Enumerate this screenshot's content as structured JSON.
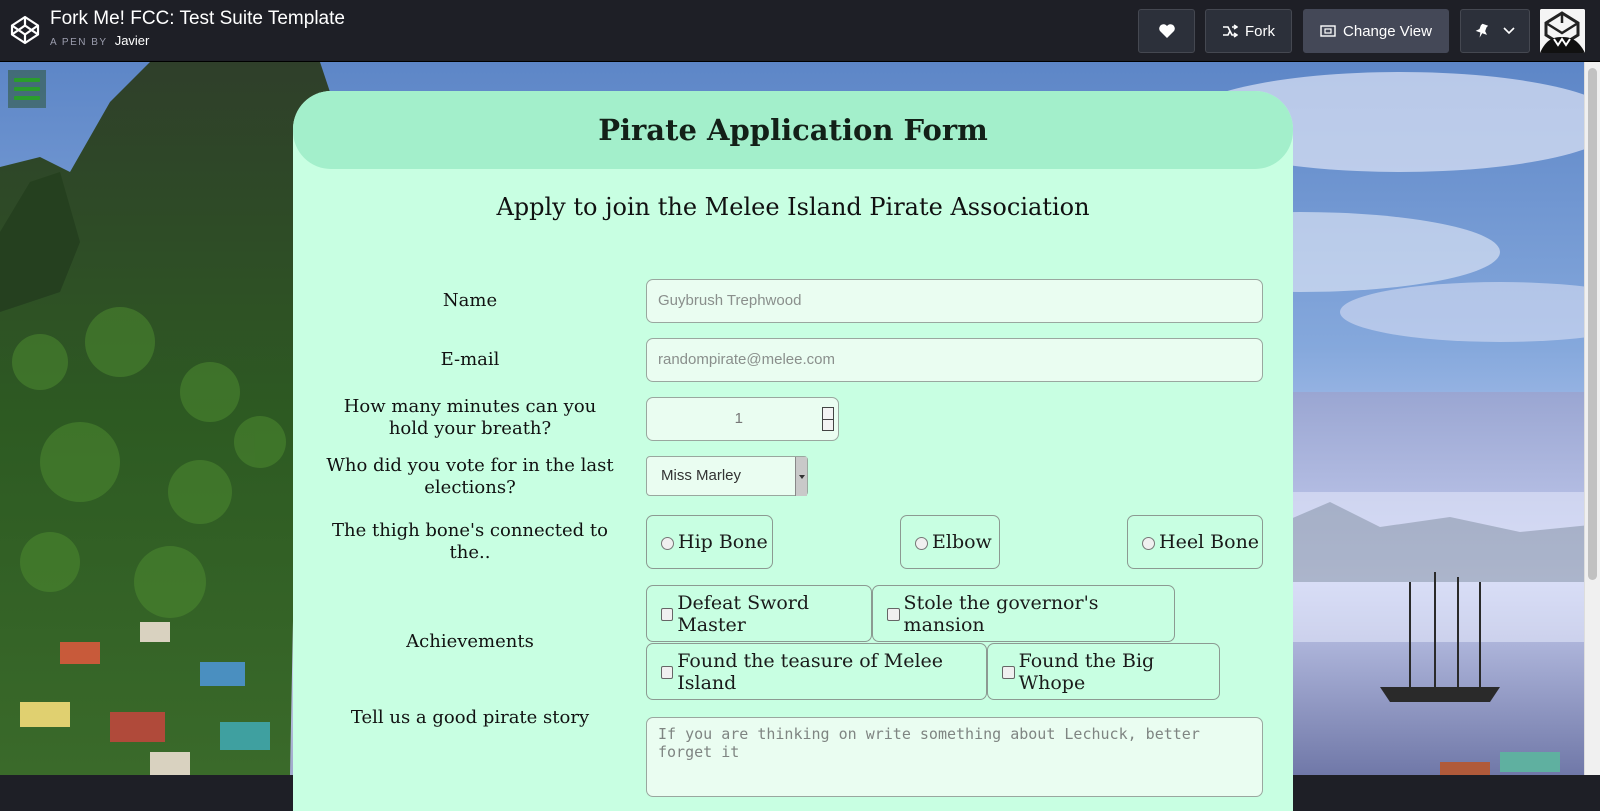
{
  "topbar": {
    "pen_title": "Fork Me! FCC: Test Suite Template",
    "pen_by_prefix": "A PEN BY",
    "author": "Javier",
    "fork_label": "Fork",
    "change_view_label": "Change View"
  },
  "form": {
    "title": "Pirate Application Form",
    "subtitle": "Apply to join the Melee Island Pirate Association",
    "name_label": "Name",
    "name_placeholder": "Guybrush Trephwood",
    "email_label": "E-mail",
    "email_placeholder": "randompirate@melee.com",
    "breath_label": "How many minutes can you hold your breath?",
    "breath_value": "1",
    "vote_label": "Who did you vote for in the last elections?",
    "vote_selected": "Miss Marley",
    "thigh_label": "The thigh bone's connected to the..",
    "thigh_options": [
      "Hip Bone",
      "Elbow",
      "Heel Bone"
    ],
    "achievements_label": "Achievements",
    "achievements": [
      "Defeat Sword Master",
      "Stole the governor's mansion",
      "Found the teasure of Melee Island",
      "Found the Big Whope"
    ],
    "story_label": "Tell us a good pirate story",
    "story_placeholder": "If you are thinking on write something about Lechuck, better forget it"
  },
  "colors": {
    "card_bg": "#c8ffe2",
    "header_bg": "#a3efcb",
    "topbar_bg": "#1e1f26"
  }
}
